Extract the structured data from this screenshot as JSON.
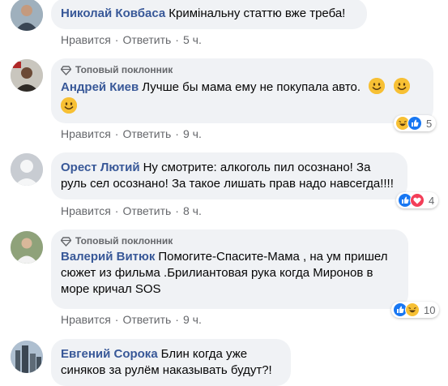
{
  "comments": [
    {
      "author": "Николай Ковбаса",
      "text": "Кримінальну статтю вже треба!",
      "badge": "",
      "like": "Нравится",
      "reply": "Ответить",
      "time": "5 ч.",
      "reaction_count": ""
    },
    {
      "author": "Андрей Киев",
      "text": "Лучше бы мама ему не покупала авто.",
      "badge": "Топовый поклонник",
      "like": "Нравится",
      "reply": "Ответить",
      "time": "9 ч.",
      "reaction_count": "5"
    },
    {
      "author": "Орест Лютий",
      "text": "Ну смотрите: алкоголь пил осознано! За руль сел осознано! За такое лишать прав надо навсегда!!!!",
      "badge": "",
      "like": "Нравится",
      "reply": "Ответить",
      "time": "8 ч.",
      "reaction_count": "4"
    },
    {
      "author": "Валерий Витюк",
      "text": "Помогите-Спасите-Мама , на ум пришел сюжет из фильма .Брилиантовая рука когда Миронов в море кричал SOS",
      "badge": "Топовый поклонник",
      "like": "Нравится",
      "reply": "Ответить",
      "time": "9 ч.",
      "reaction_count": "10"
    },
    {
      "author": "Евгений Сорока",
      "text": "Блин когда уже синяков за рулём наказывать будут?!",
      "badge": "",
      "like": "",
      "reply": "",
      "time": "",
      "reaction_count": ""
    }
  ],
  "separator": "·",
  "colors": {
    "link": "#385898",
    "bubble": "#f0f2f5",
    "meta": "#65676b",
    "like_blue": "#1877f2",
    "love_red": "#f33e58",
    "haha_yellow": "#f7c034"
  }
}
